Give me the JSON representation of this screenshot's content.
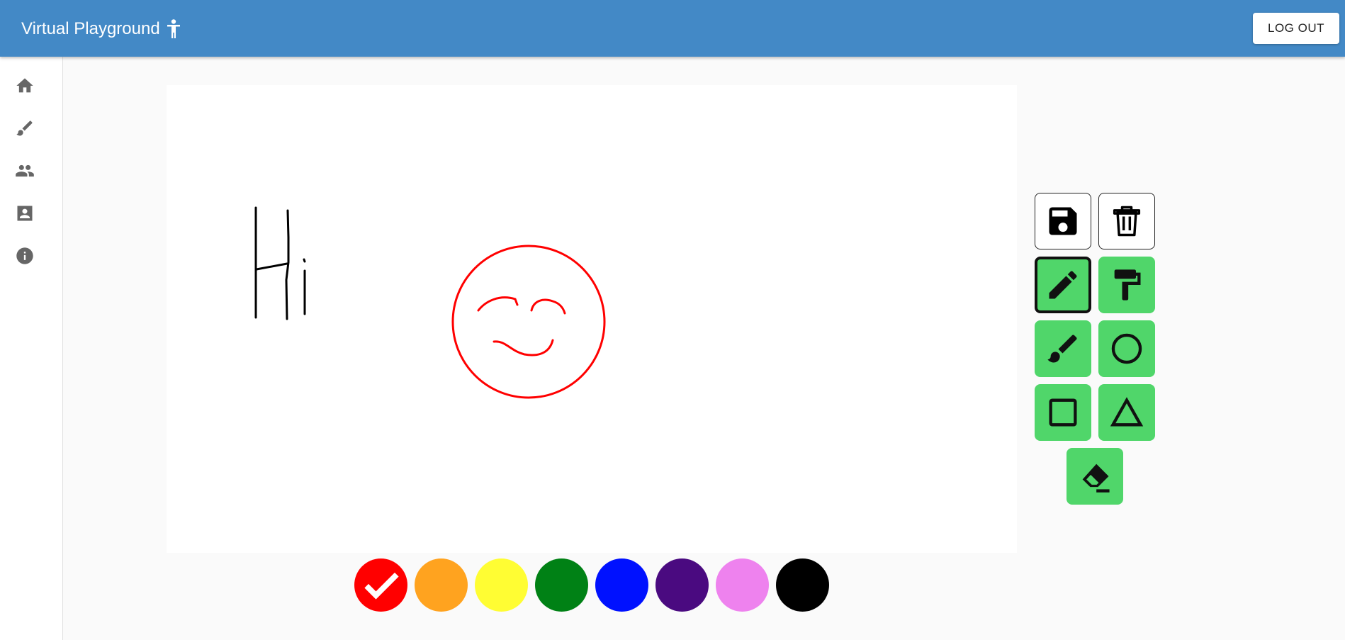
{
  "header": {
    "title": "Virtual Playground",
    "title_icon": "child-icon",
    "logout_label": "LOG OUT"
  },
  "sidebar": {
    "items": [
      {
        "name": "home",
        "icon": "home-icon"
      },
      {
        "name": "draw",
        "icon": "brush-icon"
      },
      {
        "name": "friends",
        "icon": "people-icon"
      },
      {
        "name": "profile",
        "icon": "contact-icon"
      },
      {
        "name": "about",
        "icon": "info-icon"
      }
    ]
  },
  "canvas": {
    "drawing_text": "Hi",
    "drawing_color_text": "#000000",
    "drawing_color_face": "#ff0000"
  },
  "toolbar": {
    "tools": [
      {
        "name": "save",
        "icon": "save-icon"
      },
      {
        "name": "clear",
        "icon": "trash-icon"
      },
      {
        "name": "pencil",
        "icon": "pencil-icon",
        "selected": true
      },
      {
        "name": "fill",
        "icon": "paint-roller-icon"
      },
      {
        "name": "brush",
        "icon": "brush-icon"
      },
      {
        "name": "circle",
        "icon": "circle-icon"
      },
      {
        "name": "square",
        "icon": "square-icon"
      },
      {
        "name": "triangle",
        "icon": "triangle-icon"
      },
      {
        "name": "eraser",
        "icon": "eraser-icon"
      }
    ],
    "tool_color": "#50d66a"
  },
  "palette": {
    "colors": [
      "#ff0000",
      "#ffa31f",
      "#fffd33",
      "#008115",
      "#0011ff",
      "#4a0a80",
      "#ee82ee",
      "#000000"
    ],
    "selected": "#ff0000",
    "selected_icon": "check-icon"
  }
}
